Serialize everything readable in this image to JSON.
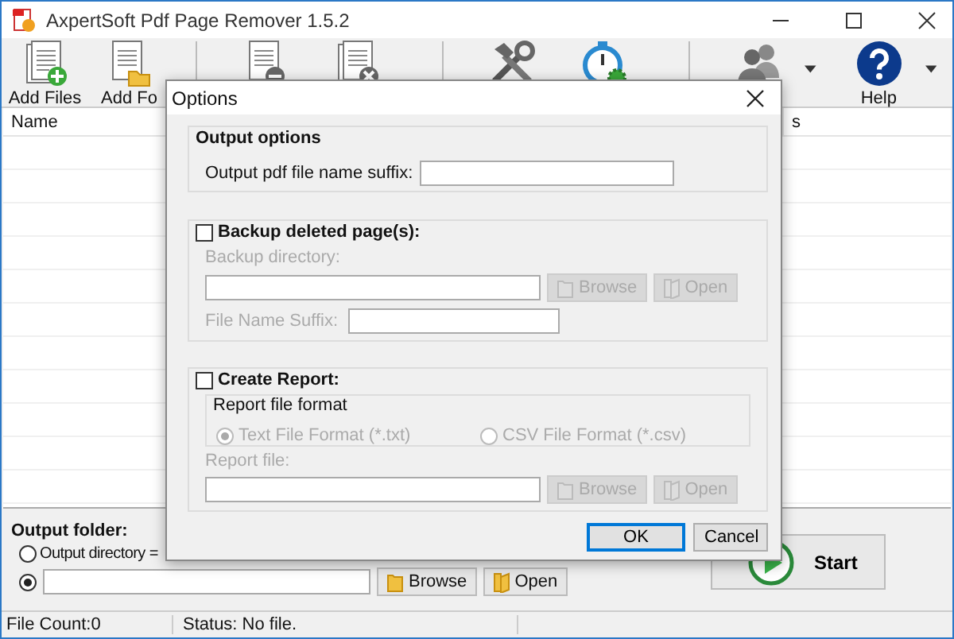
{
  "window": {
    "title": "AxpertSoft Pdf Page Remover 1.5.2"
  },
  "toolbar": [
    [
      {
        "kind": "add-files",
        "label": "Add Files"
      },
      {
        "kind": "add-folder",
        "label": "Add Fo"
      }
    ],
    [
      {
        "kind": "remove"
      },
      {
        "kind": "clear"
      }
    ],
    [
      {
        "kind": "tools"
      },
      {
        "kind": "timer"
      }
    ],
    [
      {
        "kind": "users",
        "dropdown": true
      },
      {
        "kind": "help",
        "label": "Help",
        "dropdown": true
      }
    ]
  ],
  "table": {
    "columns": [
      "Name",
      "s"
    ]
  },
  "output": {
    "title": "Output folder:",
    "options": [
      {
        "label": "Output directory =",
        "selected": false
      },
      {
        "kind": "custom",
        "selected": true
      }
    ],
    "buttons": [
      "Browse",
      "Open"
    ]
  },
  "start_button": "Start",
  "status_bar": [
    "File Count:0",
    "Status: No file."
  ],
  "dialog": {
    "title": "Options",
    "output_options": {
      "title": "Output options",
      "label": "Output pdf file name suffix:"
    },
    "backup": {
      "title": "Backup deleted page(s):",
      "checked": false,
      "disabled": true,
      "directory_label": "Backup directory:",
      "buttons": [
        "Browse",
        "Open"
      ],
      "suffix_label": "File Name Suffix:"
    },
    "report": {
      "title": "Create Report:",
      "checked": false,
      "disabled": true,
      "format_title": "Report file format",
      "formats": [
        {
          "label": "Text File Format (*.txt)",
          "selected": true
        },
        {
          "label": "CSV File Format (*.csv)",
          "selected": false
        }
      ],
      "file_label": "Report file:",
      "buttons": [
        "Browse",
        "Open"
      ]
    },
    "buttons": [
      {
        "label": "OK",
        "default": true
      },
      {
        "label": "Cancel",
        "default": false
      }
    ]
  }
}
